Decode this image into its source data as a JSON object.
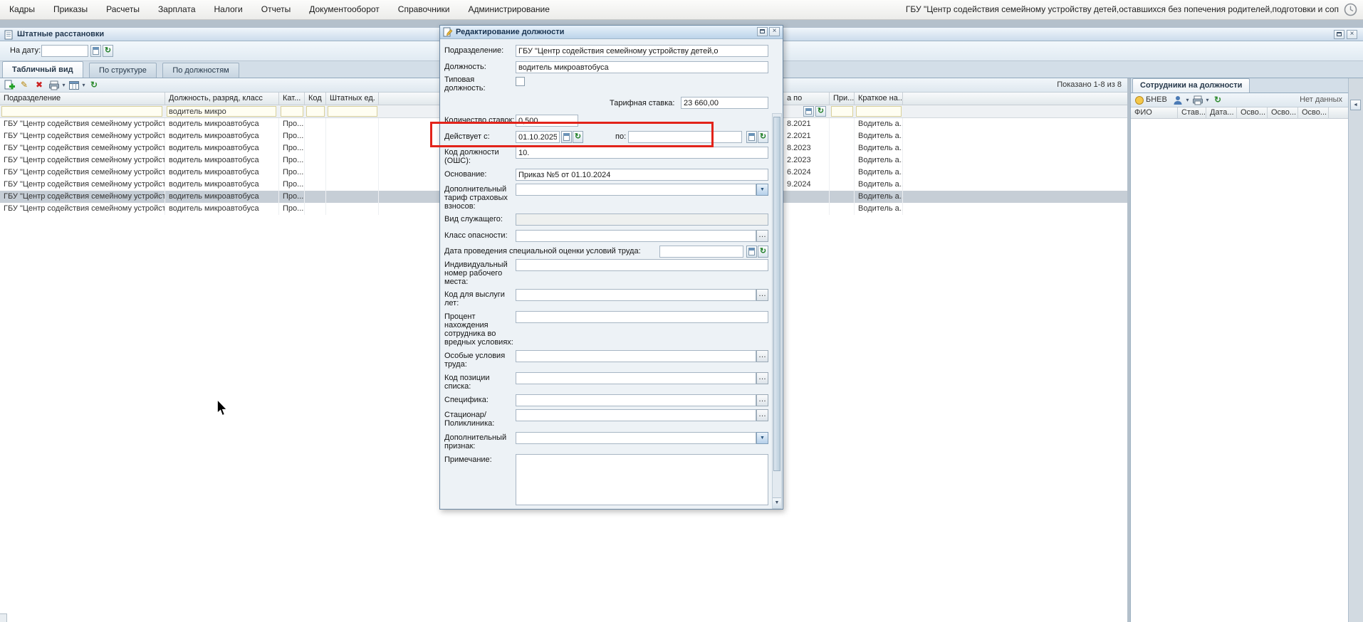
{
  "menu": {
    "items": [
      "Кадры",
      "Приказы",
      "Расчеты",
      "Зарплата",
      "Налоги",
      "Отчеты",
      "Документооборот",
      "Справочники",
      "Администрирование"
    ],
    "org_name": "ГБУ \"Центр содействия семейному устройству детей,оставшихся без попечения родителей,подготовки и соп"
  },
  "window": {
    "title": "Штатные расстановки",
    "on_date_label": "На дату:",
    "on_date_value": "",
    "tabs": [
      "Табличный вид",
      "По структуре",
      "По должностям"
    ],
    "shown_info": "Показано 1-8 из 8"
  },
  "table": {
    "columns": [
      "Подразделение",
      "Должность, разряд, класс",
      "Кат...",
      "Код",
      "Штатных ед.",
      "а по",
      "При...",
      "Краткое на..."
    ],
    "filters": {
      "position": "водитель микро"
    },
    "rows": [
      {
        "division": "ГБУ \"Центр содействия семейному устройству дете...",
        "position": "водитель микроавтобуса",
        "category": "Про...",
        "code": "",
        "units": "",
        "date_to": "8.2021",
        "pri": "",
        "short_name": "Водитель а...",
        "selected": false
      },
      {
        "division": "ГБУ \"Центр содействия семейному устройству дете...",
        "position": "водитель микроавтобуса",
        "category": "Про...",
        "code": "",
        "units": "",
        "date_to": "2.2021",
        "pri": "",
        "short_name": "Водитель а...",
        "selected": false
      },
      {
        "division": "ГБУ \"Центр содействия семейному устройству дете...",
        "position": "водитель микроавтобуса",
        "category": "Про...",
        "code": "",
        "units": "",
        "date_to": "8.2023",
        "pri": "",
        "short_name": "Водитель а...",
        "selected": false
      },
      {
        "division": "ГБУ \"Центр содействия семейному устройству дете...",
        "position": "водитель микроавтобуса",
        "category": "Про...",
        "code": "",
        "units": "",
        "date_to": "2.2023",
        "pri": "",
        "short_name": "Водитель а...",
        "selected": false
      },
      {
        "division": "ГБУ \"Центр содействия семейному устройству дете...",
        "position": "водитель микроавтобуса",
        "category": "Про...",
        "code": "",
        "units": "",
        "date_to": "6.2024",
        "pri": "",
        "short_name": "Водитель а...",
        "selected": false
      },
      {
        "division": "ГБУ \"Центр содействия семейному устройству дете...",
        "position": "водитель микроавтобуса",
        "category": "Про...",
        "code": "",
        "units": "",
        "date_to": "9.2024",
        "pri": "",
        "short_name": "Водитель а...",
        "selected": false
      },
      {
        "division": "ГБУ \"Центр содействия семейному устройству дете...",
        "position": "водитель микроавтобуса",
        "category": "Про...",
        "code": "",
        "units": "",
        "date_to": "",
        "pri": "",
        "short_name": "Водитель а...",
        "selected": true
      },
      {
        "division": "ГБУ \"Центр содействия семейному устройству дете...",
        "position": "водитель микроавтобуса",
        "category": "Про...",
        "code": "",
        "units": "",
        "date_to": "",
        "pri": "",
        "short_name": "Водитель а...",
        "selected": false
      }
    ]
  },
  "right_panel": {
    "tab": "Сотрудники на должности",
    "toolbar": {
      "bnev": "БНЕВ"
    },
    "no_data": "Нет данных",
    "columns": [
      "ФИО",
      "Став...",
      "Дата...",
      "Осво...",
      "Осво...",
      "Осво..."
    ]
  },
  "dialog": {
    "title": "Редактирование должности",
    "fields": {
      "division": {
        "label": "Подразделение:",
        "value": "ГБУ \"Центр содействия семейному устройству детей,о"
      },
      "position": {
        "label": "Должность:",
        "value": "водитель микроавтобуса"
      },
      "typical": {
        "label": "Типовая должность:",
        "checked": false
      },
      "rate": {
        "label": "Тарифная ставка:",
        "value": "23 660,00"
      },
      "quantity": {
        "label": "Количество ставок:",
        "value": "0,500"
      },
      "valid_from": {
        "label": "Действует с:",
        "value": "01.10.2025"
      },
      "valid_to": {
        "label": "по:",
        "value": ""
      },
      "code_oshs": {
        "label": "Код должности (ОШС):",
        "value": "10."
      },
      "basis": {
        "label": "Основание:",
        "value": "Приказ №5 от 01.10.2024"
      },
      "extra_tariff": {
        "label": "Дополнительный тариф страховых взносов:",
        "value": ""
      },
      "employee_kind": {
        "label": "Вид служащего:",
        "value": ""
      },
      "hazard_class": {
        "label": "Класс опасности:",
        "value": ""
      },
      "sout_date": {
        "label": "Дата проведения специальной оценки условий труда:",
        "value": ""
      },
      "workplace_number": {
        "label": "Индивидуальный номер рабочего места:",
        "value": ""
      },
      "seniority_code": {
        "label": "Код для выслуги лет:",
        "value": ""
      },
      "harmful_percent": {
        "label": "Процент нахождения сотрудника во вредных условиях:",
        "value": ""
      },
      "special_conditions": {
        "label": "Особые условия труда:",
        "value": ""
      },
      "list_position_code": {
        "label": "Код позиции списка:",
        "value": ""
      },
      "specifics": {
        "label": "Специфика:",
        "value": ""
      },
      "hospital": {
        "label": "Стационар/Поликлиника:",
        "value": ""
      },
      "extra_attr": {
        "label": "Дополнительный признак:",
        "value": ""
      },
      "note": {
        "label": "Примечание:",
        "value": ""
      }
    }
  },
  "icons": {
    "add": "+",
    "edit": "✎",
    "delete": "✖",
    "refresh": "↻",
    "green_pick": "↻",
    "dropdown": "▼",
    "menu_arrow": "▾",
    "down_arrow": "▼",
    "ellipsis": "…",
    "close": "×",
    "collapse": "◄"
  }
}
